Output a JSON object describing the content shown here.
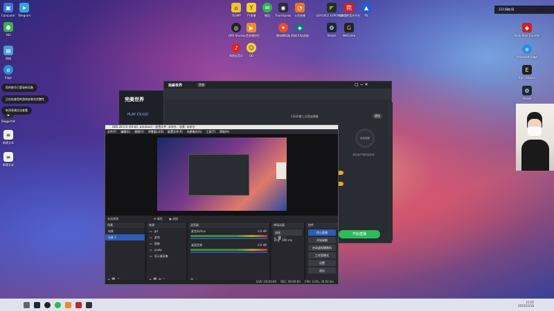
{
  "desktop_left": [
    {
      "label": "Computer"
    },
    {
      "label": "Telegram"
    },
    {
      "label": "360"
    },
    {
      "label": "网络"
    },
    {
      "label": "Edge"
    },
    {
      "label": "回收站"
    },
    {
      "label": "Daggerfall"
    },
    {
      "label": "新建文本"
    },
    {
      "label": "新建文本"
    }
  ],
  "desktop_top": [
    {
      "label": "TESMP"
    },
    {
      "label": "YY直播"
    },
    {
      "label": "微信"
    },
    {
      "label": "TeamSpeak"
    },
    {
      "label": "斗鱼直播"
    },
    {
      "label": "OBS Studio"
    },
    {
      "label": "斗鱼直播伴侣"
    },
    {
      "label": "雷电模拟器"
    },
    {
      "label": "网易UU加速器"
    },
    {
      "label": "Steam"
    },
    {
      "label": "WeGame"
    },
    {
      "label": "网易云音乐"
    },
    {
      "label": "QQ"
    },
    {
      "label": "GEFORCE EXPERIENCE"
    },
    {
      "label": "完美世界竞技平台"
    },
    {
      "label": "PS"
    }
  ],
  "desktop_right": [
    {
      "label": "Daily Rate Counter"
    },
    {
      "label": "Microsoft Edge"
    },
    {
      "label": "Epic Games"
    },
    {
      "label": "Steam"
    }
  ],
  "notifications": [
    "您的账号已登录新设备",
    "正在检查您的游戏安装包完整性",
    "新消息请点击查看"
  ],
  "app_window": {
    "logo": "完美世界",
    "tag": "PLAY CS:GO",
    "badge": "开启",
    "center_text": "CSGO第三方竞技赛事",
    "big_button": "开始直播",
    "progress_label": "自动匹配",
    "side_label": "退出",
    "hint": "请在客户端开始游戏"
  },
  "obs": {
    "title": "OBS 28.0.0 (64-bit, windows) - 配置文件: 未命名 - 场景: 未命名",
    "menus": [
      "文件(F)",
      "编辑(E)",
      "视图(V)",
      "停靠窗口(D)",
      "配置文件(P)",
      "场景集合(S)",
      "工具(T)",
      "帮助(H)"
    ],
    "toolbar_label": "未选择源",
    "props_label": "属性",
    "filters_label": "滤镜",
    "docks": {
      "scenes": {
        "title": "场景",
        "items": [
          "场景",
          "场景 2"
        ]
      },
      "sources": {
        "title": "来源",
        "items": [
          "gd",
          "游戏",
          "图像",
          "yuelp",
          "显示器采集"
        ]
      },
      "mixer": {
        "title": "混音器",
        "channels": [
          {
            "name": "麦克风/Aux",
            "db": "0.0 dB"
          },
          {
            "name": "桌面音频",
            "db": "0.0 dB"
          }
        ]
      },
      "transitions": {
        "title": "转场动画",
        "type": "淡化",
        "duration_label": "时长",
        "duration": "300 ms"
      },
      "controls": {
        "title": "控件",
        "buttons": [
          "停止直播",
          "开始录制",
          "启动虚拟摄像机",
          "工作室模式",
          "设置",
          "退出"
        ]
      }
    },
    "status": {
      "live": "LIVE: 00:00:00",
      "rec": "REC: 00:00:00",
      "cpu": "CPU: 2.0%, 30.00 fps"
    }
  },
  "taskbar": {
    "clock": "21:05",
    "date": "2022/10/18",
    "top_right": "123 网络 网"
  },
  "colors": {
    "accent_green": "#2dbb5a",
    "controls_blue": "#2b5db8",
    "app_orange": "#f4a12a"
  }
}
